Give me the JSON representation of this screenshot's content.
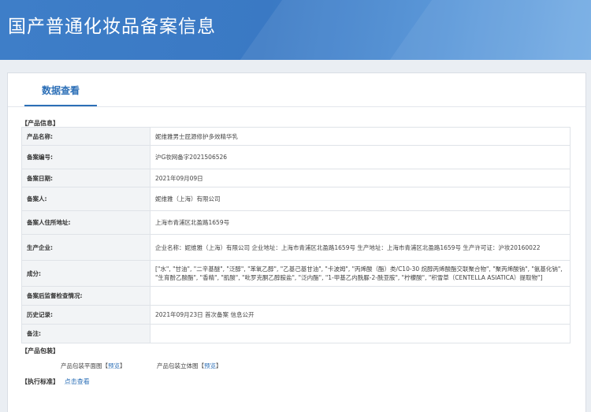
{
  "header": {
    "title": "国产普通化妆品备案信息"
  },
  "tab": {
    "label": "数据查看"
  },
  "product_info": {
    "section_label": "【产品信息】",
    "rows": [
      {
        "label": "产品名称:",
        "value": "妮维雅男士屁源修护多效精华乳"
      },
      {
        "label": "备案编号:",
        "value": "沪G妆网备字2021506526"
      },
      {
        "label": "备案日期:",
        "value": "2021年09月09日"
      },
      {
        "label": "备案人:",
        "value": "妮维雅（上海）有限公司"
      },
      {
        "label": "备案人住所地址:",
        "value": "上海市青浦区北盈路1659号"
      },
      {
        "label": "生产企业:",
        "value": "企业名称：妮维雅（上海）有限公司 企业地址：上海市青浦区北盈路1659号 生产地址：上海市青浦区北盈路1659号 生产许可证：沪妆20160022"
      },
      {
        "label": "成分:",
        "value": "[\"水\", \"甘油\", \"二辛基醚\", \"泛醇\", \"苯氧乙醇\", \"乙基己基甘油\", \"卡波姆\", \"丙烯酸（酯）类/C10-30 烷醇丙烯酸酯交联聚合物\", \"聚丙烯酸钠\", \"氨基化钠\", \"生育酚乙酸酯\", \"香精\", \"肌酸\", \"吡罗克酮乙醇胺盐\", \"泛内酯\", \"1-甲基乙内酰脲-2-酰亚胺\", \"柠檬酸\", \"积雪草（CENTELLA ASIATICA）提取物\"]"
      },
      {
        "label": "备案后监督检查情况:",
        "value": ""
      },
      {
        "label": "历史记录:",
        "value": "2021年09月23日 首次备案 信息公开"
      },
      {
        "label": "备注:",
        "value": ""
      }
    ]
  },
  "packaging": {
    "section_label": "【产品包装】",
    "flat_label": "产品包装平面图",
    "solid_label": "产品包装立体图",
    "bracket_open": "【",
    "bracket_close": "】",
    "preview_label": "预览"
  },
  "standard": {
    "section_label": "【执行标准】",
    "link_label": "点击查看"
  },
  "colors": {
    "banner": "#3e7ec8",
    "accent": "#2c6fb7"
  }
}
